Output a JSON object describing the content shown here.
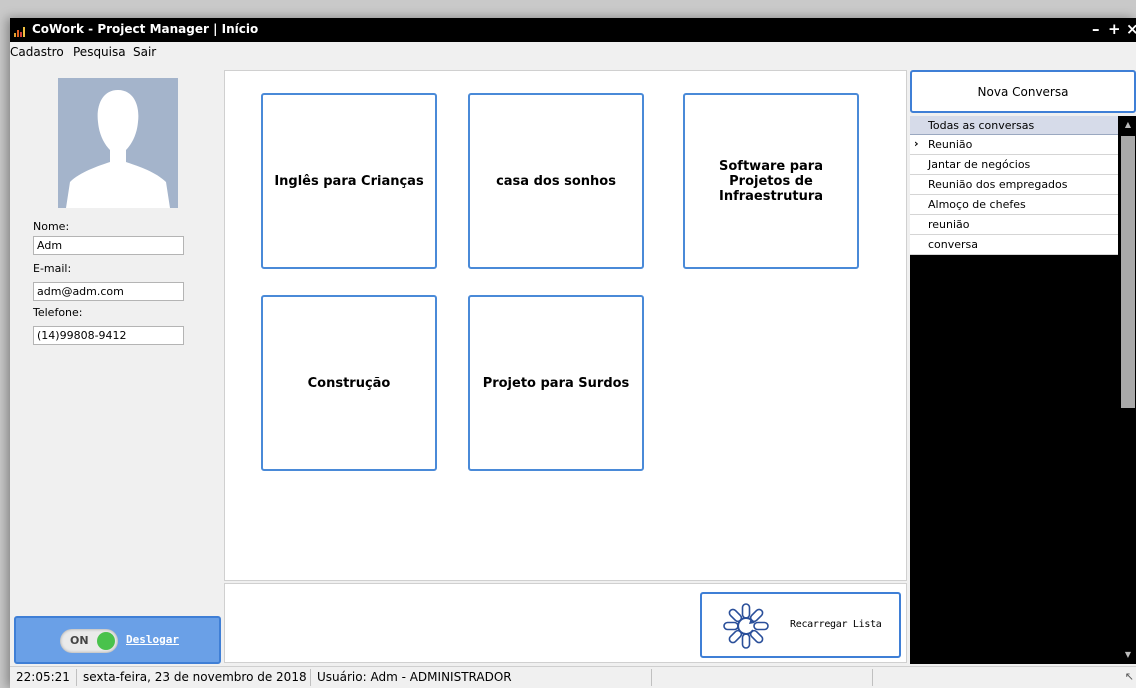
{
  "window": {
    "title": "CoWork - Project Manager | Início",
    "minimize": "–",
    "maximize": "+",
    "close": "×"
  },
  "menu": {
    "items": [
      "Cadastro",
      "Pesquisa",
      "Sair"
    ]
  },
  "profile": {
    "name_label": "Nome:",
    "name_value": "Adm",
    "email_label": "E-mail:",
    "email_value": "adm@adm.com",
    "phone_label": "Telefone:",
    "phone_value": "(14)99808-9412"
  },
  "logout": {
    "toggle_text": "ON",
    "label": "Deslogar"
  },
  "projects": [
    {
      "name": "Inglês para Crianças"
    },
    {
      "name": "casa dos sonhos"
    },
    {
      "name": "Software para Projetos de Infraestrutura"
    },
    {
      "name": "Construção"
    },
    {
      "name": "Projeto para Surdos"
    }
  ],
  "reload": {
    "label": "Recarregar Lista"
  },
  "chat": {
    "new_button": "Nova Conversa",
    "header": "Todas as conversas",
    "items": [
      "Reunião",
      "Jantar de negócios",
      "Reunião dos empregados",
      "Almoço de chefes",
      "reunião",
      "conversa"
    ],
    "selected_indicator": "›"
  },
  "status": {
    "time": "22:05:21",
    "date": "sexta-feira, 23 de novembro de 2018",
    "user": "Usuário: Adm - ADMINISTRADOR"
  },
  "colors": {
    "accent": "#3f7fd6",
    "logout_bg": "#6aa0e7",
    "toggle_on": "#49c24c",
    "avatar": "#a4b4cb",
    "titlebar": "#000000"
  }
}
